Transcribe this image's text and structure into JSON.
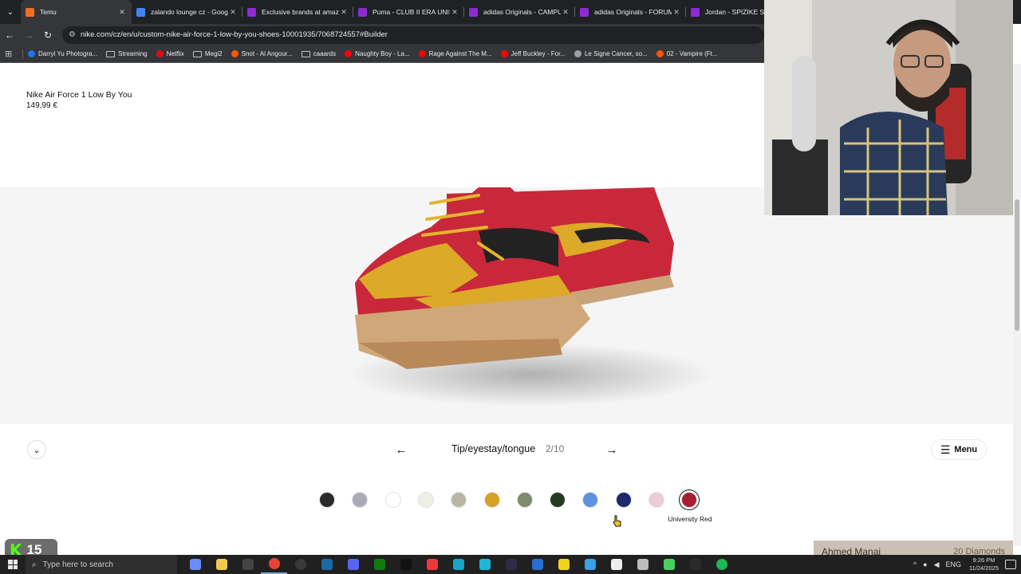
{
  "browser": {
    "tabs": [
      {
        "title": "Temu",
        "color": "#f26f21",
        "active": true
      },
      {
        "title": "zalando lounge cz - Google",
        "color": "#4285f4",
        "active": false
      },
      {
        "title": "Exclusive brands at amazing",
        "color": "#8f2ad6",
        "active": false
      },
      {
        "title": "Puma - CLUB II ERA UNISEX",
        "color": "#8f2ad6",
        "active": false
      },
      {
        "title": "adidas Originals - CAMPUS",
        "color": "#8f2ad6",
        "active": false
      },
      {
        "title": "adidas Originals - FORUM",
        "color": "#8f2ad6",
        "active": false
      },
      {
        "title": "Jordan - SPIZIKE SE - T",
        "color": "#8f2ad6",
        "active": false
      }
    ],
    "url": "nike.com/cz/en/u/custom-nike-air-force-1-low-by-you-shoes-10001935/7068724557#Builder",
    "bookmarks": [
      {
        "label": "Darryl Yu Photogra...",
        "color": "#1877f2"
      },
      {
        "label": "Streaming",
        "color": "folder"
      },
      {
        "label": "Netflix",
        "color": "#e50914"
      },
      {
        "label": "Megi2",
        "color": "folder"
      },
      {
        "label": "Snot - Al Angour...",
        "color": "#ff5500"
      },
      {
        "label": "caaards",
        "color": "folder"
      },
      {
        "label": "Naughty Boy - La...",
        "color": "#ff0000"
      },
      {
        "label": "Rage Against The M...",
        "color": "#ff0000"
      },
      {
        "label": "Jeff Buckley - For...",
        "color": "#ff0000"
      },
      {
        "label": "Le Signe Cancer, so...",
        "color": "#9aa0a6"
      },
      {
        "label": "02 - Vampire (Ft...",
        "color": "#ff5500"
      }
    ]
  },
  "product": {
    "title": "Nike Air Force 1 Low By You",
    "price": "149,99 €"
  },
  "builder": {
    "step_label": "Tip/eyestay/tongue",
    "step_count": "2/10",
    "menu_label": "Menu",
    "selected_color_name": "University Red",
    "swatches": [
      {
        "color": "#2b2b2b"
      },
      {
        "color": "#a9acb4"
      },
      {
        "color": "#ffffff"
      },
      {
        "color": "#efeee4"
      },
      {
        "color": "#b9b6a8"
      },
      {
        "color": "#d6a124"
      },
      {
        "color": "#7e8c6d"
      },
      {
        "color": "#25391f"
      },
      {
        "color": "#5e92de"
      },
      {
        "color": "#1c2a6b"
      },
      {
        "color": "#eccdd6"
      },
      {
        "color": "#a61d34",
        "selected": true
      }
    ]
  },
  "overlay": {
    "kick_count": "15",
    "streamer_name": "Ahmed Manai",
    "diamonds": "20 Diamonds"
  },
  "taskbar": {
    "search_placeholder": "Type here to search",
    "language": "ENG",
    "time": "9:26 PM",
    "date": "11/24/2025",
    "apps": [
      {
        "name": "copilot",
        "color": "#6b8cff"
      },
      {
        "name": "file-explorer",
        "color": "#f2c94c"
      },
      {
        "name": "epic-games",
        "color": "#444444"
      },
      {
        "name": "chrome",
        "color": "#e94235",
        "running": true
      },
      {
        "name": "obs",
        "color": "#3a3a3a"
      },
      {
        "name": "steam",
        "color": "#1b6aa5"
      },
      {
        "name": "discord-alt",
        "color": "#5865f2"
      },
      {
        "name": "xbox",
        "color": "#107c10"
      },
      {
        "name": "tiktok",
        "color": "#111111"
      },
      {
        "name": "vivaldi",
        "color": "#ef3939"
      },
      {
        "name": "app-m",
        "color": "#1aa3c9"
      },
      {
        "name": "app-cyan",
        "color": "#1fb6d8"
      },
      {
        "name": "app-dark",
        "color": "#2d2d4a"
      },
      {
        "name": "app-blue",
        "color": "#2b6cd3"
      },
      {
        "name": "app-yellow",
        "color": "#f2d21c"
      },
      {
        "name": "app-sky",
        "color": "#3aa0e8"
      },
      {
        "name": "capcut",
        "color": "#eeeeee"
      },
      {
        "name": "app-g",
        "color": "#bbbbbb"
      },
      {
        "name": "app-green-play",
        "color": "#46d160"
      },
      {
        "name": "app-terminal",
        "color": "#2a2a2a"
      },
      {
        "name": "spotify",
        "color": "#1db954"
      }
    ]
  }
}
